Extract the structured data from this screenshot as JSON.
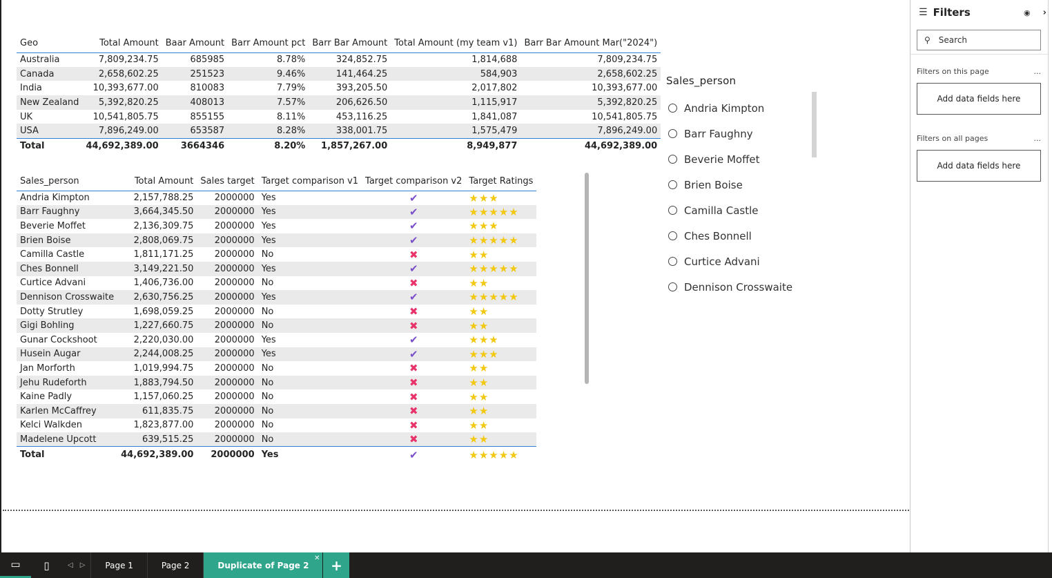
{
  "geo_table": {
    "headers": [
      "Geo",
      "Total Amount",
      "Baar Amount",
      "Barr Amount pct",
      "Barr Bar Amount",
      "Total Amount (my team v1)",
      "Barr Bar Amount Mar(\"2024\")"
    ],
    "rows": [
      [
        "Australia",
        "7,809,234.75",
        "685985",
        "8.78%",
        "324,852.75",
        "1,814,688",
        "7,809,234.75"
      ],
      [
        "Canada",
        "2,658,602.25",
        "251523",
        "9.46%",
        "141,464.25",
        "584,903",
        "2,658,602.25"
      ],
      [
        "India",
        "10,393,677.00",
        "810083",
        "7.79%",
        "393,205.50",
        "2,017,802",
        "10,393,677.00"
      ],
      [
        "New Zealand",
        "5,392,820.25",
        "408013",
        "7.57%",
        "206,626.50",
        "1,115,917",
        "5,392,820.25"
      ],
      [
        "UK",
        "10,541,805.75",
        "855155",
        "8.11%",
        "453,116.25",
        "1,841,087",
        "10,541,805.75"
      ],
      [
        "USA",
        "7,896,249.00",
        "653587",
        "8.28%",
        "338,001.75",
        "1,575,479",
        "7,896,249.00"
      ]
    ],
    "total": [
      "Total",
      "44,692,389.00",
      "3664346",
      "8.20%",
      "1,857,267.00",
      "8,949,877",
      "44,692,389.00"
    ]
  },
  "sales_table": {
    "headers": [
      "Sales_person",
      "Total Amount",
      "Sales target",
      "Target comparison v1",
      "Target comparison v2",
      "Target Ratings"
    ],
    "rows": [
      {
        "name": "Andria Kimpton",
        "amount": "2,157,788.25",
        "target": "2000000",
        "v1": "Yes",
        "v2": "check",
        "stars": "★★★"
      },
      {
        "name": "Barr Faughny",
        "amount": "3,664,345.50",
        "target": "2000000",
        "v1": "Yes",
        "v2": "check",
        "stars": "★★★★★"
      },
      {
        "name": "Beverie Moffet",
        "amount": "2,136,309.75",
        "target": "2000000",
        "v1": "Yes",
        "v2": "check",
        "stars": "★★★"
      },
      {
        "name": "Brien Boise",
        "amount": "2,808,069.75",
        "target": "2000000",
        "v1": "Yes",
        "v2": "check",
        "stars": "★★★★★"
      },
      {
        "name": "Camilla Castle",
        "amount": "1,811,171.25",
        "target": "2000000",
        "v1": "No",
        "v2": "cross",
        "stars": "★★"
      },
      {
        "name": "Ches Bonnell",
        "amount": "3,149,221.50",
        "target": "2000000",
        "v1": "Yes",
        "v2": "check",
        "stars": "★★★★★"
      },
      {
        "name": "Curtice Advani",
        "amount": "1,406,736.00",
        "target": "2000000",
        "v1": "No",
        "v2": "cross",
        "stars": "★★"
      },
      {
        "name": "Dennison Crosswaite",
        "amount": "2,630,756.25",
        "target": "2000000",
        "v1": "Yes",
        "v2": "check",
        "stars": "★★★★★"
      },
      {
        "name": "Dotty Strutley",
        "amount": "1,698,059.25",
        "target": "2000000",
        "v1": "No",
        "v2": "cross",
        "stars": "★★"
      },
      {
        "name": "Gigi Bohling",
        "amount": "1,227,660.75",
        "target": "2000000",
        "v1": "No",
        "v2": "cross",
        "stars": "★★"
      },
      {
        "name": "Gunar Cockshoot",
        "amount": "2,220,030.00",
        "target": "2000000",
        "v1": "Yes",
        "v2": "check",
        "stars": "★★★"
      },
      {
        "name": "Husein Augar",
        "amount": "2,244,008.25",
        "target": "2000000",
        "v1": "Yes",
        "v2": "check",
        "stars": "★★★"
      },
      {
        "name": "Jan Morforth",
        "amount": "1,019,994.75",
        "target": "2000000",
        "v1": "No",
        "v2": "cross",
        "stars": "★★"
      },
      {
        "name": "Jehu Rudeforth",
        "amount": "1,883,794.50",
        "target": "2000000",
        "v1": "No",
        "v2": "cross",
        "stars": "★★"
      },
      {
        "name": "Kaine Padly",
        "amount": "1,157,060.25",
        "target": "2000000",
        "v1": "No",
        "v2": "cross",
        "stars": "★★"
      },
      {
        "name": "Karlen McCaffrey",
        "amount": "611,835.75",
        "target": "2000000",
        "v1": "No",
        "v2": "cross",
        "stars": "★★"
      },
      {
        "name": "Kelci Walkden",
        "amount": "1,823,877.00",
        "target": "2000000",
        "v1": "No",
        "v2": "cross",
        "stars": "★★"
      },
      {
        "name": "Madelene Upcott",
        "amount": "639,515.25",
        "target": "2000000",
        "v1": "No",
        "v2": "cross",
        "stars": "★★"
      }
    ],
    "total": {
      "name": "Total",
      "amount": "44,692,389.00",
      "target": "2000000",
      "v1": "Yes",
      "v2": "check",
      "stars": "★★★★★"
    }
  },
  "icons": {
    "check": "✔",
    "cross": "✖"
  },
  "slicer": {
    "title": "Sales_person",
    "items": [
      "Andria Kimpton",
      "Barr Faughny",
      "Beverie Moffet",
      "Brien Boise",
      "Camilla Castle",
      "Ches Bonnell",
      "Curtice Advani",
      "Dennison Crosswaite"
    ]
  },
  "filters": {
    "title": "Filters",
    "search_placeholder": "Search",
    "this_page_label": "Filters on this page",
    "all_pages_label": "Filters on all pages",
    "more": "...",
    "add_fields": "Add data fields here"
  },
  "tabs": {
    "pages": [
      "Page 1",
      "Page 2",
      "Duplicate of Page 2"
    ],
    "active_index": 2,
    "add_label": "+"
  },
  "colors": {
    "accent": "#2fa58b",
    "check": "#7b4fc9",
    "cross": "#e8336a",
    "star": "#f2c811",
    "header_line": "#2f7fd2"
  }
}
